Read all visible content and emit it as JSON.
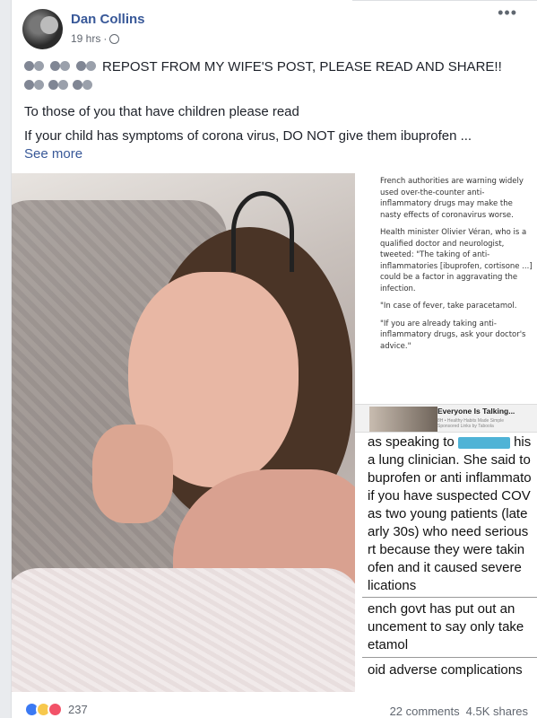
{
  "post": {
    "author": "Dan Collins",
    "time": "19 hrs",
    "time_separator": "·",
    "more": "•••",
    "line1": "REPOST FROM MY WIFE'S POST, PLEASE READ AND SHARE!!",
    "line2": "To those of you that have children please read",
    "line3": "If your child has symptoms of corona virus, DO NOT give them ibuprofen ...",
    "see_more": "See more"
  },
  "icons": {
    "avatar": "avatar-photo",
    "globe": "globe-icon",
    "more": "more-options-icon",
    "crying_emoji": "crying-face-icon"
  },
  "article": {
    "p1": "French authorities are warning widely used over-the-counter anti-inflammatory drugs may make the nasty effects of coronavirus worse.",
    "p2": "Health minister Olivier Véran, who is a qualified doctor and neurologist, tweeted: \"The taking of anti-inflammatories [ibuprofen, cortisone ...] could be a factor in aggravating the infection.",
    "p3": "\"In case of fever, take paracetamol.",
    "p4": "\"If you are already taking anti-inflammatory drugs, ask your doctor's advice.\""
  },
  "ad": {
    "title": "Everyone Is Talking...",
    "sub": "8H • Healthy Habits Made Simple",
    "sub2": "Sponsored Links by Taboola"
  },
  "zoom_text": {
    "l1a": "as speaking to",
    "l1b": "his",
    "l2": "a lung clinician. She said to",
    "l3": "buprofen or anti inflammato",
    "l4": "if you have suspected COV",
    "l5": "as two young patients (late",
    "l6": "arly 30s) who need serious",
    "l7": "rt because they were takin",
    "l8": "ofen and it caused severe",
    "l9": "lications",
    "l10": "ench govt has put out an",
    "l11": "uncement to say only take",
    "l12": "etamol",
    "l13": "oid adverse complications"
  },
  "footer": {
    "reaction_count": "237",
    "comments": "22 comments",
    "shares": "4.5K shares"
  },
  "colors": {
    "link": "#385898",
    "like": "#3b79f3",
    "love": "#f25268",
    "sad": "#f7c84d",
    "redaction": "#4fb3d6"
  }
}
